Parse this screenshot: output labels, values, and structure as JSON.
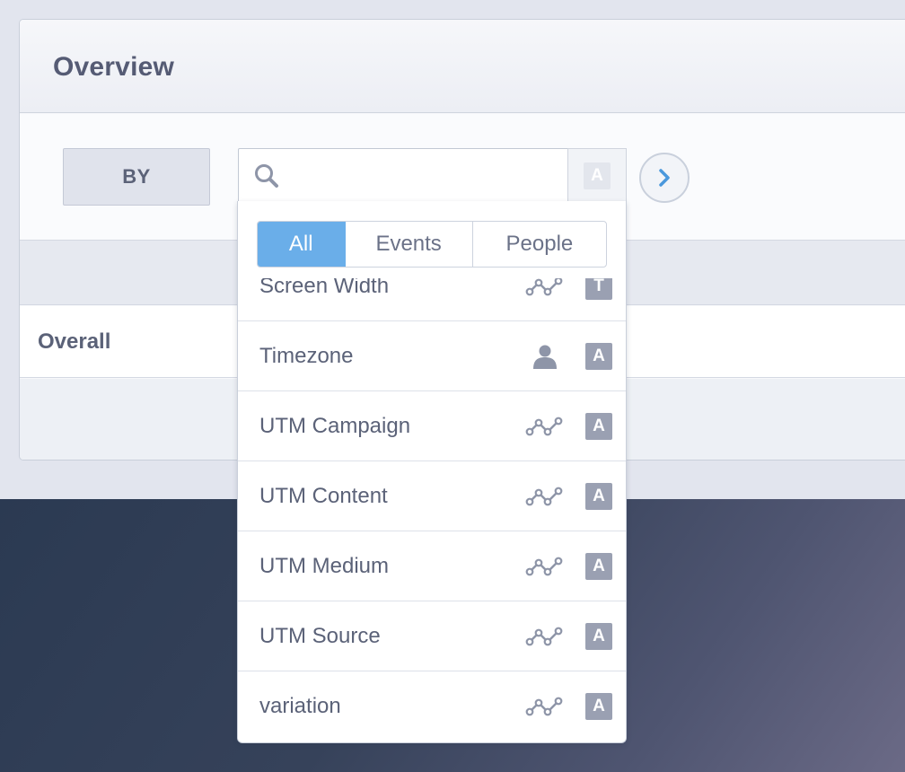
{
  "panel": {
    "title": "Overview",
    "by_label": "BY",
    "search_placeholder": "",
    "type_badge": "A",
    "overall_label": "Overall"
  },
  "dropdown": {
    "filters": [
      {
        "label": "All",
        "active": true
      },
      {
        "label": "Events",
        "active": false
      },
      {
        "label": "People",
        "active": false
      }
    ],
    "items": [
      {
        "label": "Screen Width",
        "kind": "event-icon",
        "type": "T"
      },
      {
        "label": "Timezone",
        "kind": "person-icon",
        "type": "A"
      },
      {
        "label": "UTM Campaign",
        "kind": "event-icon",
        "type": "A"
      },
      {
        "label": "UTM Content",
        "kind": "event-icon",
        "type": "A"
      },
      {
        "label": "UTM Medium",
        "kind": "event-icon",
        "type": "A"
      },
      {
        "label": "UTM Source",
        "kind": "event-icon",
        "type": "A"
      },
      {
        "label": "variation",
        "kind": "event-icon",
        "type": "A"
      }
    ]
  },
  "colors": {
    "accent": "#6aaee9",
    "badge": "#9aa0b2",
    "text": "#5b6278",
    "dark_bg": "#2b3a52"
  }
}
